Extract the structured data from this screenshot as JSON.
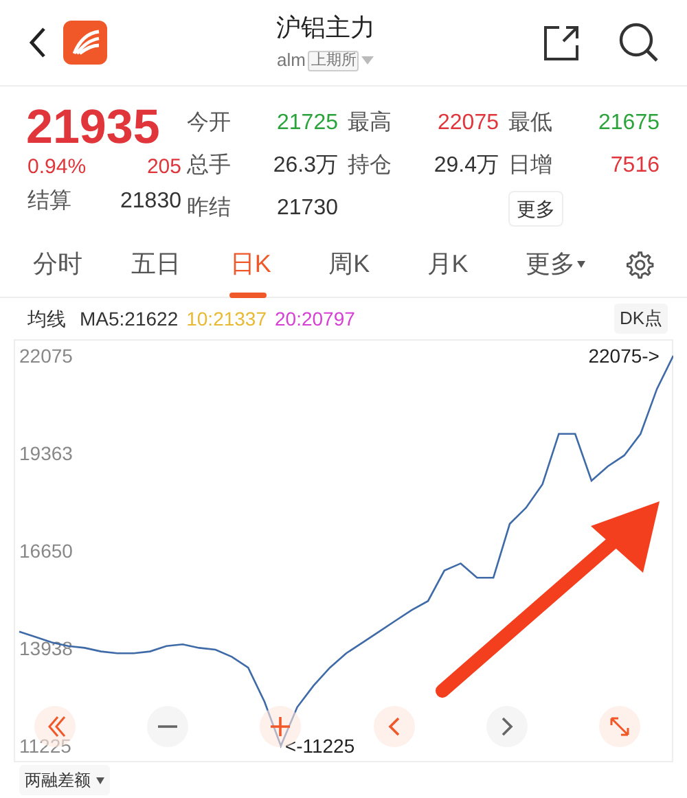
{
  "header": {
    "title": "沪铝主力",
    "code": "alm",
    "exchange": "上期所"
  },
  "quote": {
    "price": "21935",
    "change_pct": "0.94%",
    "change": "205",
    "settle_label": "结算",
    "settle": "21830",
    "stats": [
      {
        "label": "今开",
        "value": "21725",
        "color": "#2aa33a"
      },
      {
        "label": "最高",
        "value": "22075",
        "color": "#e0363b"
      },
      {
        "label": "最低",
        "value": "21675",
        "color": "#2aa33a"
      },
      {
        "label": "总手",
        "value": "26.3万",
        "color": "#333333"
      },
      {
        "label": "持仓",
        "value": "29.4万",
        "color": "#333333"
      },
      {
        "label": "日增",
        "value": "7516",
        "color": "#e0363b"
      },
      {
        "label": "昨结",
        "value": "21730",
        "color": "#333333"
      }
    ],
    "more_button": "更多"
  },
  "tabs": [
    {
      "label": "分时",
      "selected": false
    },
    {
      "label": "五日",
      "selected": false
    },
    {
      "label": "日K",
      "selected": true
    },
    {
      "label": "周K",
      "selected": false
    },
    {
      "label": "月K",
      "selected": false
    },
    {
      "label": "更多",
      "selected": false,
      "dropdown": true
    }
  ],
  "ma_legend": [
    {
      "text": "均线",
      "color": "#333333"
    },
    {
      "text": "MA5:21622",
      "color": "#333333"
    },
    {
      "text": "10:21337",
      "color": "#e8b931"
    },
    {
      "text": "20:20797",
      "color": "#d53fd3"
    }
  ],
  "dk_button": "DK点",
  "chart": {
    "chart_data": {
      "type": "line",
      "yticks": [
        {
          "value": 22075,
          "label": "22075"
        },
        {
          "value": 19363,
          "label": "19363"
        },
        {
          "value": 16650,
          "label": "16650"
        },
        {
          "value": 13938,
          "label": "13938"
        },
        {
          "value": 11225,
          "label": "11225"
        }
      ],
      "ylim": [
        10767,
        22533
      ],
      "series": [
        {
          "color": "#3f6aa8",
          "values": [
            14400,
            14250,
            14100,
            14000,
            13950,
            13850,
            13800,
            13800,
            13850,
            14000,
            14050,
            13950,
            13900,
            13700,
            13400,
            12450,
            11225,
            12300,
            12900,
            13400,
            13800,
            14100,
            14400,
            14700,
            15000,
            15250,
            16100,
            16300,
            15900,
            15900,
            17400,
            17850,
            18500,
            19900,
            19900,
            18600,
            19000,
            19300,
            19900,
            21150,
            22075
          ]
        }
      ],
      "annotations": [
        "22075->",
        "<-11225"
      ]
    }
  },
  "bottom_button": "两融差额"
}
